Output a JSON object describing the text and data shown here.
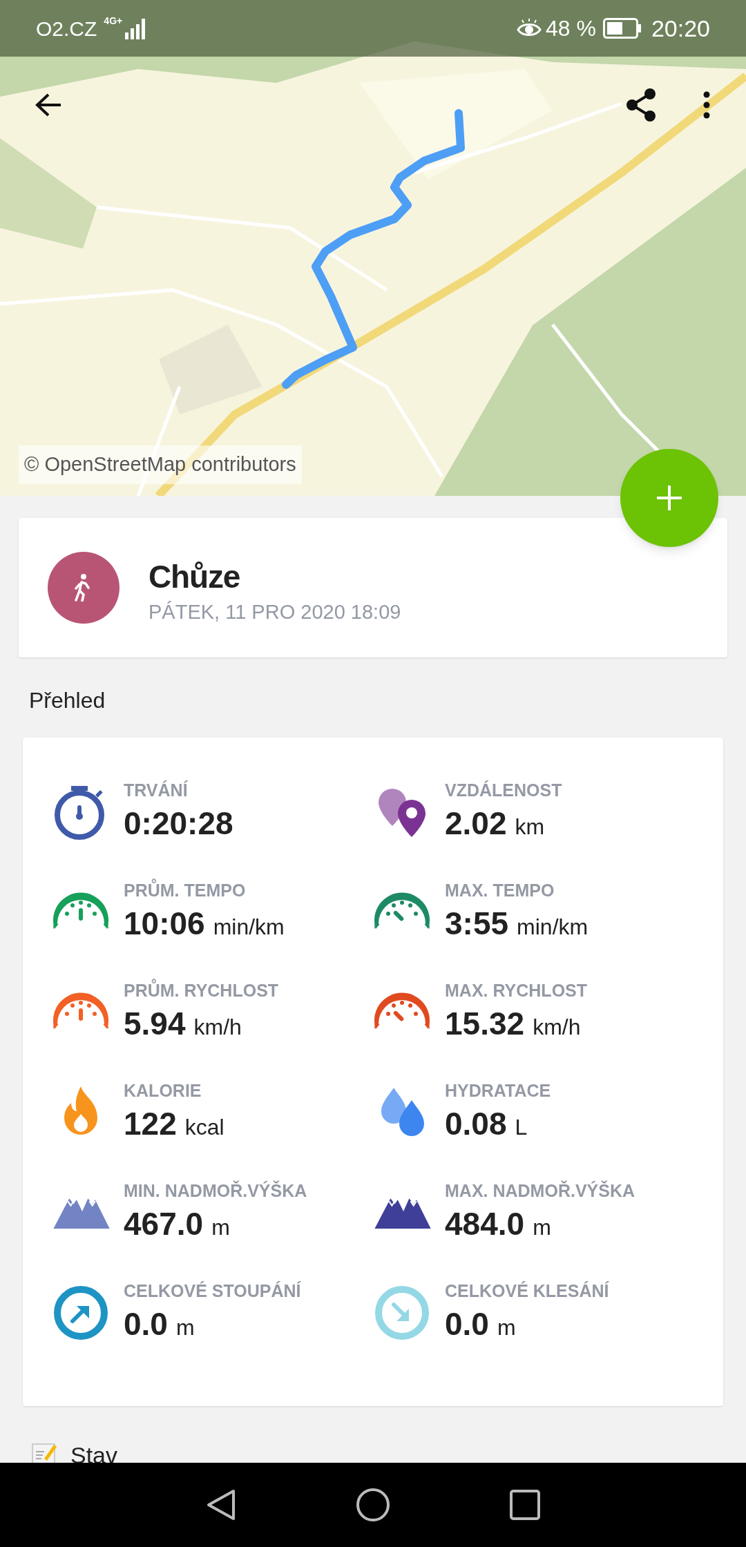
{
  "status_bar": {
    "carrier": "O2.CZ",
    "network": "4G+",
    "battery": "48 %",
    "time": "20:20"
  },
  "map": {
    "attribution": "© OpenStreetMap contributors"
  },
  "activity": {
    "title": "Chůze",
    "date": "PÁTEK, 11 PRO 2020 18:09"
  },
  "overview": {
    "heading": "Přehled",
    "stats": [
      {
        "kind": "stopwatch",
        "color": "#3f5aa8",
        "label": "TRVÁNÍ",
        "value": "0:20:28"
      },
      {
        "kind": "pins",
        "color": "#7b3393",
        "label": "VZDÁLENOST",
        "value": "2.02",
        "unit": "km"
      },
      {
        "kind": "gauge-avg",
        "color": "#16a05a",
        "label": "PRŮM. TEMPO",
        "value": "10:06",
        "unit": "min/km"
      },
      {
        "kind": "gauge-max",
        "color": "#1d8a65",
        "label": "MAX. TEMPO",
        "value": "3:55",
        "unit": "min/km"
      },
      {
        "kind": "gauge-avg",
        "color": "#f26025",
        "label": "PRŮM. RYCHLOST",
        "value": "5.94",
        "unit": "km/h"
      },
      {
        "kind": "gauge-max",
        "color": "#e04a1f",
        "label": "MAX. RYCHLOST",
        "value": "15.32",
        "unit": "km/h"
      },
      {
        "kind": "flame",
        "color": "#f7941d",
        "label": "KALORIE",
        "value": "122",
        "unit": "kcal"
      },
      {
        "kind": "drops",
        "color": "#3d86f0",
        "label": "HYDRATACE",
        "value": "0.08",
        "unit": "L"
      },
      {
        "kind": "mountains",
        "color": "#7284c4",
        "label": "MIN. NADMOŘ.VÝŠKA",
        "value": "467.0",
        "unit": "m"
      },
      {
        "kind": "mountains",
        "color": "#3f3f99",
        "label": "MAX. NADMOŘ.VÝŠKA",
        "value": "484.0",
        "unit": "m"
      },
      {
        "kind": "arrow-up",
        "color": "#1e94c4",
        "label": "CELKOVÉ STOUPÁNÍ",
        "value": "0.0",
        "unit": "m"
      },
      {
        "kind": "arrow-down",
        "color": "#94d8e6",
        "label": "CELKOVÉ KLESÁNÍ",
        "value": "0.0",
        "unit": "m"
      }
    ]
  },
  "notes": {
    "heading": "Stav"
  }
}
